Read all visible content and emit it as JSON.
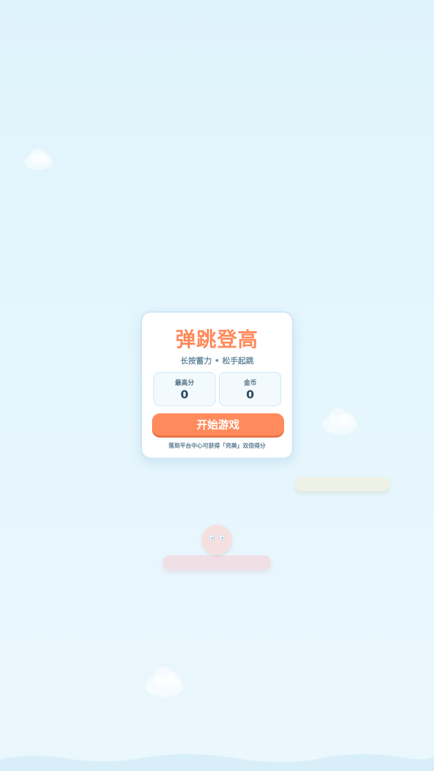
{
  "game": {
    "title": "弹跳登高",
    "subtitle": "长按蓄力 • 松手起跳",
    "stats": {
      "best_label": "最高分",
      "best_value": "0",
      "coins_label": "金币",
      "coins_value": "0"
    },
    "start_button_label": "开始游戏",
    "hint": "落到平台中心可获得「完美」双倍得分"
  },
  "colors": {
    "accent": "#ff8a5c",
    "sky_top": "#dff3fc",
    "sky_bottom": "#eaf7fd",
    "panel_border": "#cfe8f6",
    "text_muted": "#6c8ea2",
    "text_dark": "#2a4b60"
  }
}
